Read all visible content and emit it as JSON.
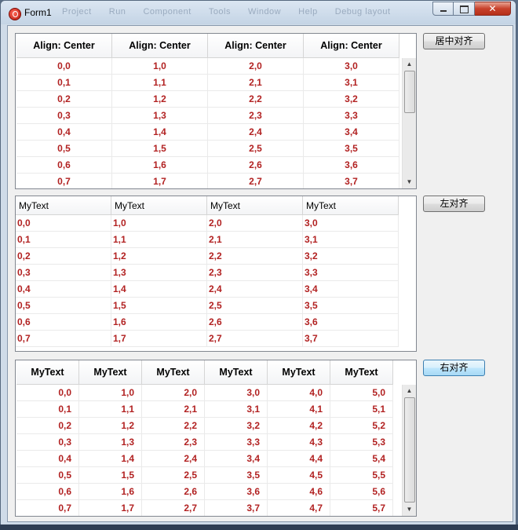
{
  "window": {
    "title": "Form1",
    "ghost_menu": [
      "Project",
      "Run",
      "Component",
      "Tools",
      "Window",
      "Help",
      "Debug layout"
    ]
  },
  "buttons": {
    "center": "居中对齐",
    "left": "左对齐",
    "right": "右对齐"
  },
  "grid1": {
    "headers": [
      "Align: Center",
      "Align: Center",
      "Align: Center",
      "Align: Center"
    ],
    "rows": [
      [
        "0,0",
        "1,0",
        "2,0",
        "3,0"
      ],
      [
        "0,1",
        "1,1",
        "2,1",
        "3,1"
      ],
      [
        "0,2",
        "1,2",
        "2,2",
        "3,2"
      ],
      [
        "0,3",
        "1,3",
        "2,3",
        "3,3"
      ],
      [
        "0,4",
        "1,4",
        "2,4",
        "3,4"
      ],
      [
        "0,5",
        "1,5",
        "2,5",
        "3,5"
      ],
      [
        "0,6",
        "1,6",
        "2,6",
        "3,6"
      ],
      [
        "0,7",
        "1,7",
        "2,7",
        "3,7"
      ]
    ]
  },
  "grid2": {
    "headers": [
      "MyText",
      "MyText",
      "MyText",
      "MyText"
    ],
    "rows": [
      [
        "0,0",
        "1,0",
        "2,0",
        "3,0"
      ],
      [
        "0,1",
        "1,1",
        "2,1",
        "3,1"
      ],
      [
        "0,2",
        "1,2",
        "2,2",
        "3,2"
      ],
      [
        "0,3",
        "1,3",
        "2,3",
        "3,3"
      ],
      [
        "0,4",
        "1,4",
        "2,4",
        "3,4"
      ],
      [
        "0,5",
        "1,5",
        "2,5",
        "3,5"
      ],
      [
        "0,6",
        "1,6",
        "2,6",
        "3,6"
      ],
      [
        "0,7",
        "1,7",
        "2,7",
        "3,7"
      ]
    ]
  },
  "grid3": {
    "headers": [
      "MyText",
      "MyText",
      "MyText",
      "MyText",
      "MyText",
      "MyText"
    ],
    "rows": [
      [
        "0,0",
        "1,0",
        "2,0",
        "3,0",
        "4,0",
        "5,0"
      ],
      [
        "0,1",
        "1,1",
        "2,1",
        "3,1",
        "4,1",
        "5,1"
      ],
      [
        "0,2",
        "1,2",
        "2,2",
        "3,2",
        "4,2",
        "5,2"
      ],
      [
        "0,3",
        "1,3",
        "2,3",
        "3,3",
        "4,3",
        "5,3"
      ],
      [
        "0,4",
        "1,4",
        "2,4",
        "3,4",
        "4,4",
        "5,4"
      ],
      [
        "0,5",
        "1,5",
        "2,5",
        "3,5",
        "4,5",
        "5,5"
      ],
      [
        "0,6",
        "1,6",
        "2,6",
        "3,6",
        "4,6",
        "5,6"
      ],
      [
        "0,7",
        "1,7",
        "2,7",
        "3,7",
        "4,7",
        "5,7"
      ]
    ]
  },
  "colors": {
    "cell_text": "#b22222",
    "header_text": "#000000"
  }
}
